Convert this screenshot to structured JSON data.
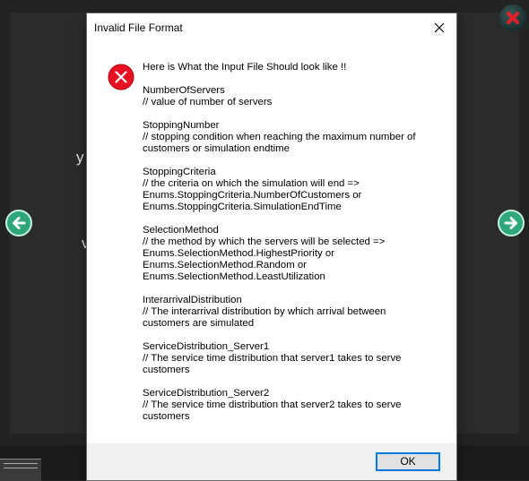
{
  "background": {
    "letters": [
      "y",
      "v"
    ]
  },
  "dialog": {
    "title": "Invalid File Format",
    "message_lines": [
      "Here is What the Input File Should look like !!",
      "",
      "NumberOfServers",
      "// value of number of servers",
      "",
      "StoppingNumber",
      "// stopping condition when reaching the maximum number of",
      "customers or simulation endtime",
      "",
      "StoppingCriteria",
      "// the criteria on which the simulation will end =>",
      "Enums.StoppingCriteria.NumberOfCustomers or",
      "Enums.StoppingCriteria.SimulationEndTime",
      "",
      "SelectionMethod",
      "// the method by which the servers will be selected =>",
      "Enums.SelectionMethod.HighestPriority or",
      "Enums.SelectionMethod.Random or",
      "Enums.SelectionMethod.LeastUtilization",
      "",
      "InterarrivalDistribution",
      "// The interarrival distribution by which arrival between",
      "customers are simulated",
      "",
      "ServiceDistribution_Server1",
      "// The service time distribution that server1 takes to serve",
      "customers",
      "",
      "ServiceDistribution_Server2",
      "// The service time distribution that server2 takes to serve",
      "customers"
    ],
    "ok_label": "OK",
    "icon": "error-icon"
  },
  "colors": {
    "error": "#e81123",
    "nav": "#2ea77a",
    "button_border": "#0078d7"
  }
}
